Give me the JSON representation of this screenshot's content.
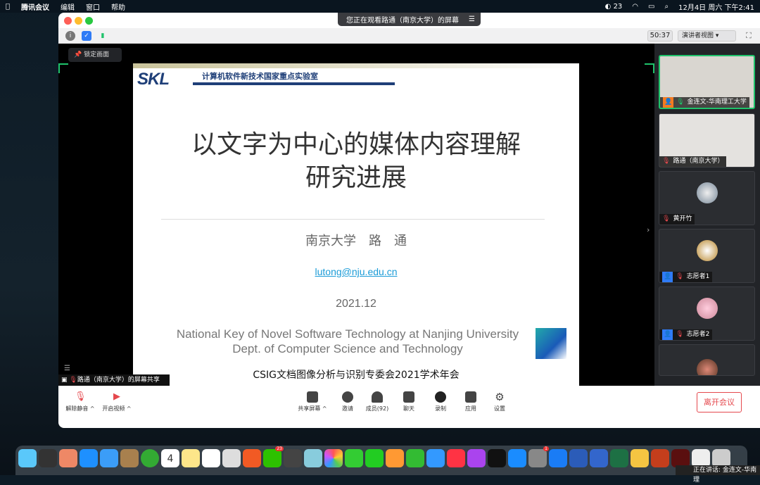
{
  "menubar": {
    "app": "腾讯会议",
    "items": [
      "编辑",
      "窗口",
      "帮助"
    ],
    "wechat_count": "23",
    "datetime": "12月4日 周六 下午2:41"
  },
  "window": {
    "banner": "您正在观看路通（南京大学）的屏幕",
    "timer": "50:37",
    "view_mode": "演讲者视图"
  },
  "stage": {
    "pin_label": "锁定画面"
  },
  "slide": {
    "lab_logo": "SKL",
    "lab_name": "计算机软件新技术国家重点实验室",
    "title_line1": "以文字为中心的媒体内容理解",
    "title_line2": "研究进展",
    "author": "南京大学　路　通",
    "email": "lutong@nju.edu.cn",
    "date": "2021.12",
    "footer1": "National Key of Novel Software Technology at Nanjing University",
    "footer2": "Dept. of Computer Science and Technology",
    "conference": "CSIG文档图像分析与识别专委会2021学术年会",
    "accent": "#1f3f78"
  },
  "participants": [
    {
      "name": "金连文-华南理工大学",
      "active": true
    },
    {
      "name": "路通（南京大学）"
    },
    {
      "name": "黄开竹"
    },
    {
      "name": "志愿者1"
    },
    {
      "name": "志愿者2"
    },
    {
      "name": ""
    }
  ],
  "share_label": "路通（南京大学）的屏幕共享",
  "controls": {
    "unmute": "解除静音",
    "video": "开启视频",
    "share": "共享屏幕",
    "invite": "邀请",
    "members": "成员(92)",
    "chat": "聊天",
    "record": "录制",
    "apps": "应用",
    "settings": "设置",
    "leave": "离开会议"
  },
  "dock": {
    "wechat_badge": "23",
    "settings_badge": "1",
    "calendar_day": "4"
  },
  "speaking": "正在讲话: 金连文-华南理"
}
